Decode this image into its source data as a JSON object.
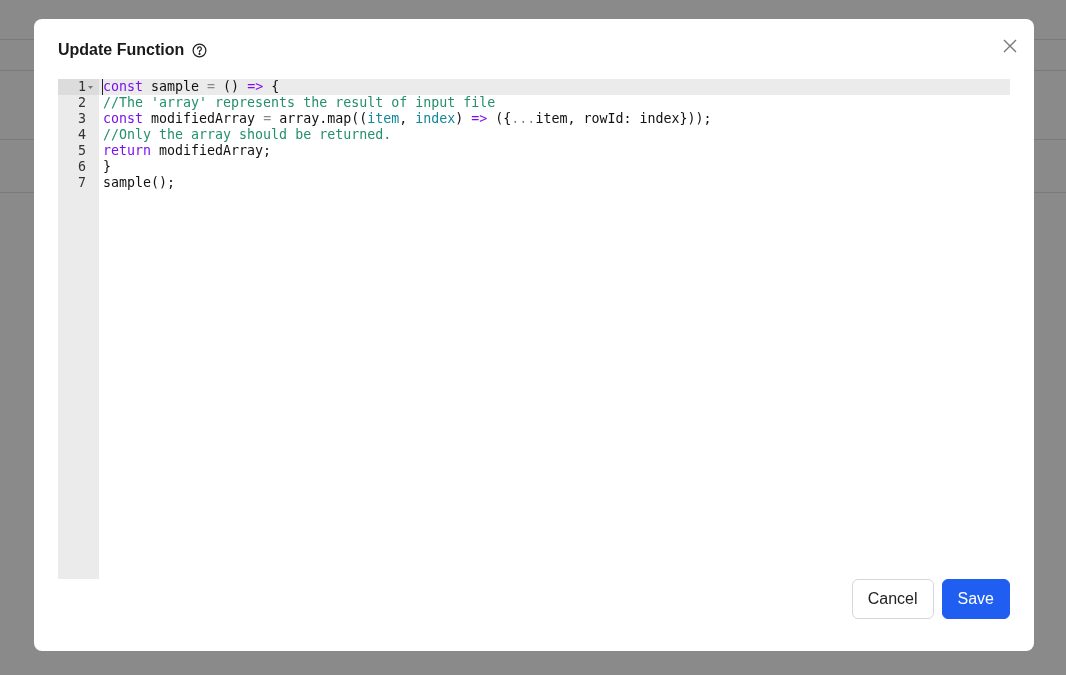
{
  "dialog": {
    "title": "Update Function",
    "editor": {
      "lines": [
        {
          "number": "1",
          "active": true,
          "foldable": true,
          "tokens": [
            {
              "kind": "keyword",
              "text": "const"
            },
            {
              "kind": "plain",
              "text": " sample "
            },
            {
              "kind": "punct",
              "text": "="
            },
            {
              "kind": "plain",
              "text": " () "
            },
            {
              "kind": "keyword",
              "text": "=>"
            },
            {
              "kind": "plain",
              "text": " {"
            }
          ]
        },
        {
          "number": "2",
          "active": false,
          "foldable": false,
          "tokens": [
            {
              "kind": "comment",
              "text": "//The 'array' represents the result of input file"
            }
          ]
        },
        {
          "number": "3",
          "active": false,
          "foldable": false,
          "tokens": [
            {
              "kind": "keyword",
              "text": "const"
            },
            {
              "kind": "plain",
              "text": " modifiedArray "
            },
            {
              "kind": "punct",
              "text": "="
            },
            {
              "kind": "plain",
              "text": " array.map(("
            },
            {
              "kind": "param",
              "text": "item"
            },
            {
              "kind": "plain",
              "text": ", "
            },
            {
              "kind": "param",
              "text": "index"
            },
            {
              "kind": "plain",
              "text": ") "
            },
            {
              "kind": "keyword",
              "text": "=>"
            },
            {
              "kind": "plain",
              "text": " ({"
            },
            {
              "kind": "punct",
              "text": "..."
            },
            {
              "kind": "plain",
              "text": "item, rowId: index}));"
            }
          ]
        },
        {
          "number": "4",
          "active": false,
          "foldable": false,
          "tokens": [
            {
              "kind": "comment",
              "text": "//Only the array should be returned."
            }
          ]
        },
        {
          "number": "5",
          "active": false,
          "foldable": false,
          "tokens": [
            {
              "kind": "keyword",
              "text": "return"
            },
            {
              "kind": "plain",
              "text": " modifiedArray;"
            }
          ]
        },
        {
          "number": "6",
          "active": false,
          "foldable": false,
          "tokens": [
            {
              "kind": "plain",
              "text": "}"
            }
          ]
        },
        {
          "number": "7",
          "active": false,
          "foldable": false,
          "tokens": [
            {
              "kind": "plain",
              "text": "sample();"
            }
          ]
        }
      ]
    },
    "buttons": [
      {
        "label": "Cancel",
        "kind": "secondary"
      },
      {
        "label": "Save",
        "kind": "primary"
      }
    ]
  }
}
